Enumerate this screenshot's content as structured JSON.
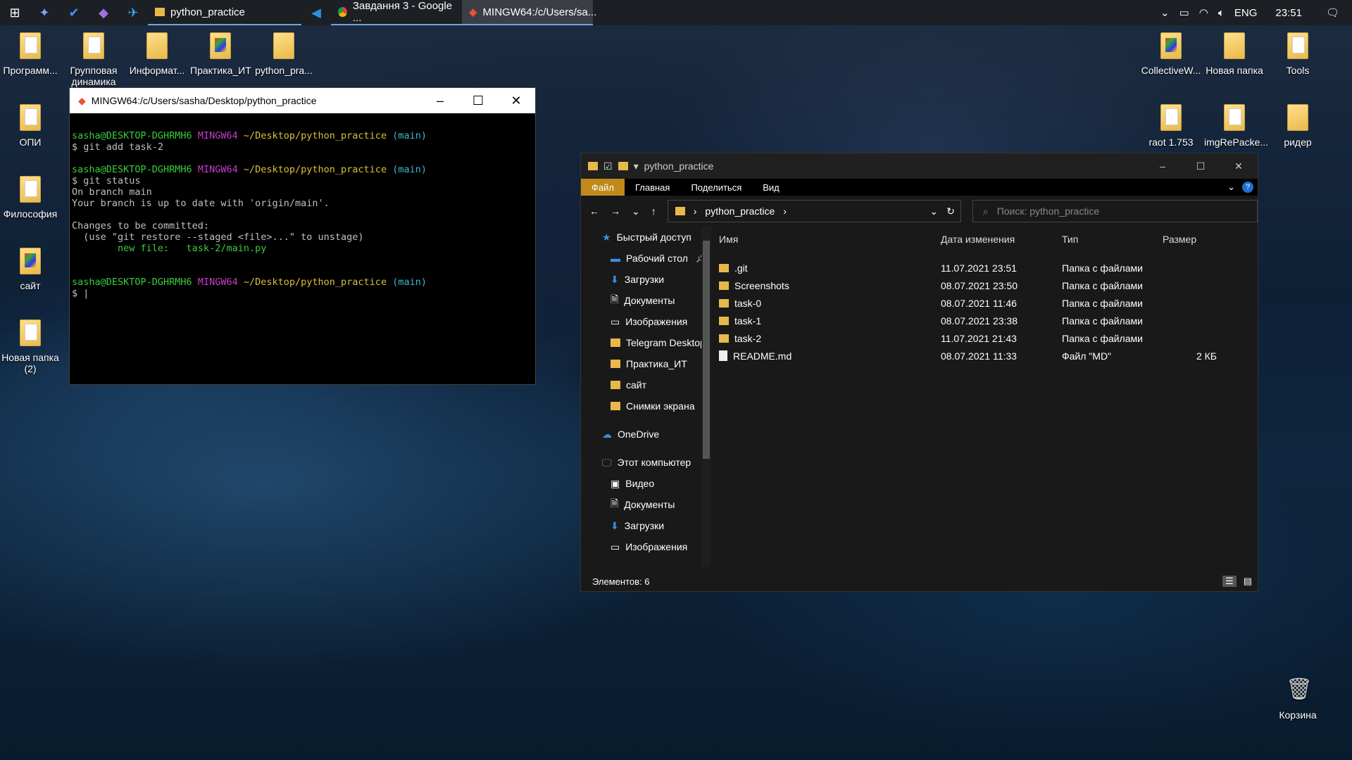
{
  "taskbar": {
    "tasks": [
      {
        "label": "python_practice",
        "icon": "folder-icon"
      },
      {
        "label": "Завдання 3 - Google ...",
        "icon": "chrome-icon"
      },
      {
        "label": "MINGW64:/c/Users/sa...",
        "icon": "git-icon"
      }
    ],
    "lang": "ENG",
    "time": "23:51"
  },
  "desktop": {
    "left_icons": [
      "Программ...",
      "Групповая динамика",
      "Информат...",
      "Практика_ИТ",
      "python_pra...",
      "ОПИ",
      "Философия",
      "сайт",
      "Новая папка (2)"
    ],
    "right_icons": [
      "CollectiveW...",
      "Новая папка",
      "Tools",
      "raot 1.753",
      "imgRePacke...",
      "ридер"
    ],
    "recycle": "Корзина"
  },
  "terminal": {
    "title": "MINGW64:/c/Users/sasha/Desktop/python_practice",
    "user": "sasha@DESKTOP-DGHRMH6",
    "env": "MINGW64",
    "path": "~/Desktop/python_practice",
    "branch": "(main)",
    "cmd1": "$ git add task-2",
    "cmd2": "$ git status",
    "out1": "On branch main",
    "out2": "Your branch is up to date with 'origin/main'.",
    "out3": "Changes to be committed:",
    "out4": "  (use \"git restore --staged <file>...\" to unstage)",
    "out5": "        new file:   task-2/main.py",
    "prompt": "$ |"
  },
  "explorer": {
    "title": "python_practice",
    "tabs": [
      "Файл",
      "Главная",
      "Поделиться",
      "Вид"
    ],
    "address": "python_practice",
    "search_placeholder": "Поиск: python_practice",
    "sidebar": [
      {
        "label": "Быстрый доступ",
        "top": true
      },
      {
        "label": "Рабочий стол"
      },
      {
        "label": "Загрузки"
      },
      {
        "label": "Документы"
      },
      {
        "label": "Изображения"
      },
      {
        "label": "Telegram Desktop"
      },
      {
        "label": "Практика_ИТ"
      },
      {
        "label": "сайт"
      },
      {
        "label": "Снимки экрана"
      },
      {
        "label": "OneDrive",
        "top": true
      },
      {
        "label": "Этот компьютер",
        "top": true
      },
      {
        "label": "Видео"
      },
      {
        "label": "Документы"
      },
      {
        "label": "Загрузки"
      },
      {
        "label": "Изображения"
      }
    ],
    "columns": [
      "Имя",
      "Дата изменения",
      "Тип",
      "Размер"
    ],
    "files": [
      {
        "name": ".git",
        "date": "11.07.2021 23:51",
        "type": "Папка с файлами",
        "size": ""
      },
      {
        "name": "Screenshots",
        "date": "08.07.2021 23:50",
        "type": "Папка с файлами",
        "size": ""
      },
      {
        "name": "task-0",
        "date": "08.07.2021 11:46",
        "type": "Папка с файлами",
        "size": ""
      },
      {
        "name": "task-1",
        "date": "08.07.2021 23:38",
        "type": "Папка с файлами",
        "size": ""
      },
      {
        "name": "task-2",
        "date": "11.07.2021 21:43",
        "type": "Папка с файлами",
        "size": ""
      },
      {
        "name": "README.md",
        "date": "08.07.2021 11:33",
        "type": "Файл \"MD\"",
        "size": "2 КБ"
      }
    ],
    "status": "Элементов: 6"
  }
}
